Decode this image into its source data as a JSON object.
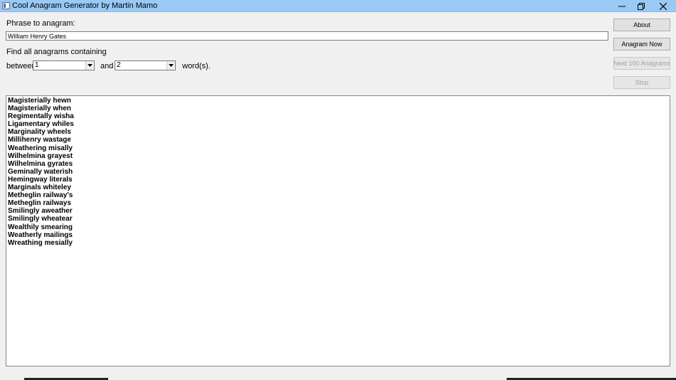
{
  "window": {
    "title": "Cool Anagram Generator by Martin Mamo"
  },
  "form": {
    "phrase_label": "Phrase to anagram:",
    "phrase_value": "William Henry Gates",
    "find_label": "Find all anagrams containing",
    "between_label": "between",
    "from_value": "1",
    "and_label": "and",
    "to_value": "2",
    "words_label": "word(s)."
  },
  "buttons": {
    "about": "About",
    "anagram_now": "Anagram Now",
    "next_100": "Next 100 Anagrams",
    "stop": "Stop"
  },
  "results": [
    "Magisterially hewn",
    "Magisterially when",
    "Regimentally wisha",
    "Ligamentary whiles",
    "Marginality wheels",
    "Millihenry wastage",
    "Weathering misally",
    "Wilhelmina grayest",
    "Wilhelmina gyrates",
    "Geminally waterish",
    "Hemingway literals",
    "Marginals whiteley",
    "Metheglin railway's",
    "Metheglin railways",
    "Smilingly aweather",
    "Smilingly wheatear",
    "Wealthily smearing",
    "Weatherly mailings",
    "Wreathing mesially"
  ]
}
